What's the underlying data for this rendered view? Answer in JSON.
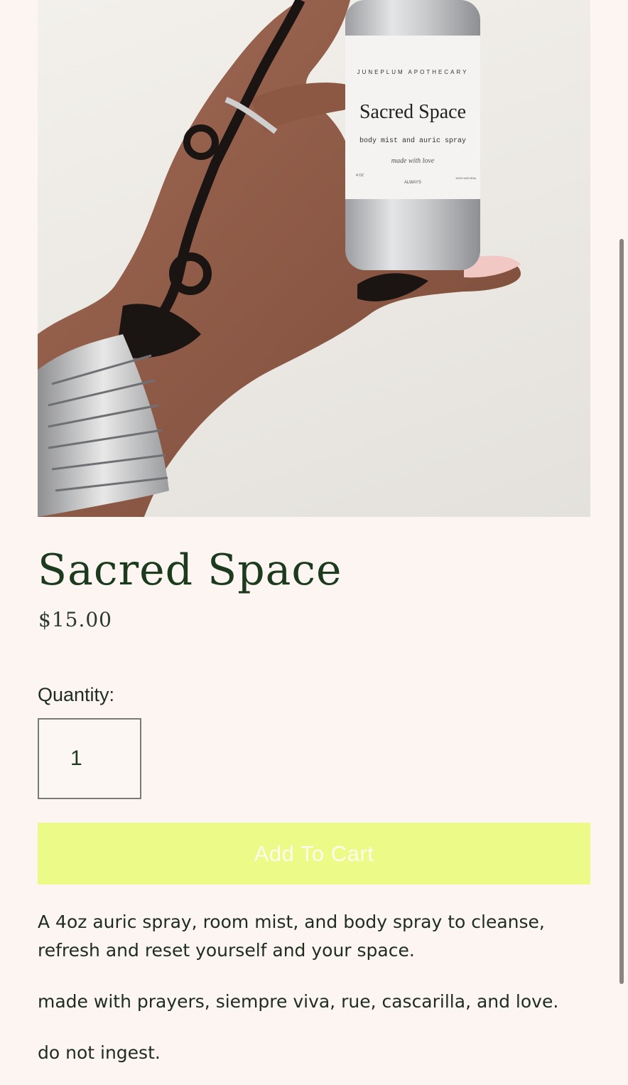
{
  "product": {
    "image": {
      "alt": "Hand holding Sacred Space bottle",
      "label_brand": "JUNEPLUM APOTHECARY",
      "label_title": "Sacred Space",
      "label_subtitle": "body mist and auric spray",
      "label_script": "made with love",
      "label_footer_left": "4 OZ",
      "label_footer_mid": "ALWAYS",
      "label_footer_right": "100% NATURAL"
    },
    "title": "Sacred Space",
    "price": "$15.00",
    "quantity_label": "Quantity:",
    "quantity_value": "1",
    "add_to_cart_label": "Add To Cart",
    "description": [
      "A 4oz auric spray, room mist, and body spray to cleanse, refresh and reset yourself and your space.",
      "made with prayers, siempre viva, rue, cascarilla, and love.",
      "do not ingest."
    ]
  },
  "colors": {
    "background": "#fcf5f1",
    "title": "#1c3a1e",
    "button": "#ecfa87",
    "button_text": "#fbfbf0"
  }
}
